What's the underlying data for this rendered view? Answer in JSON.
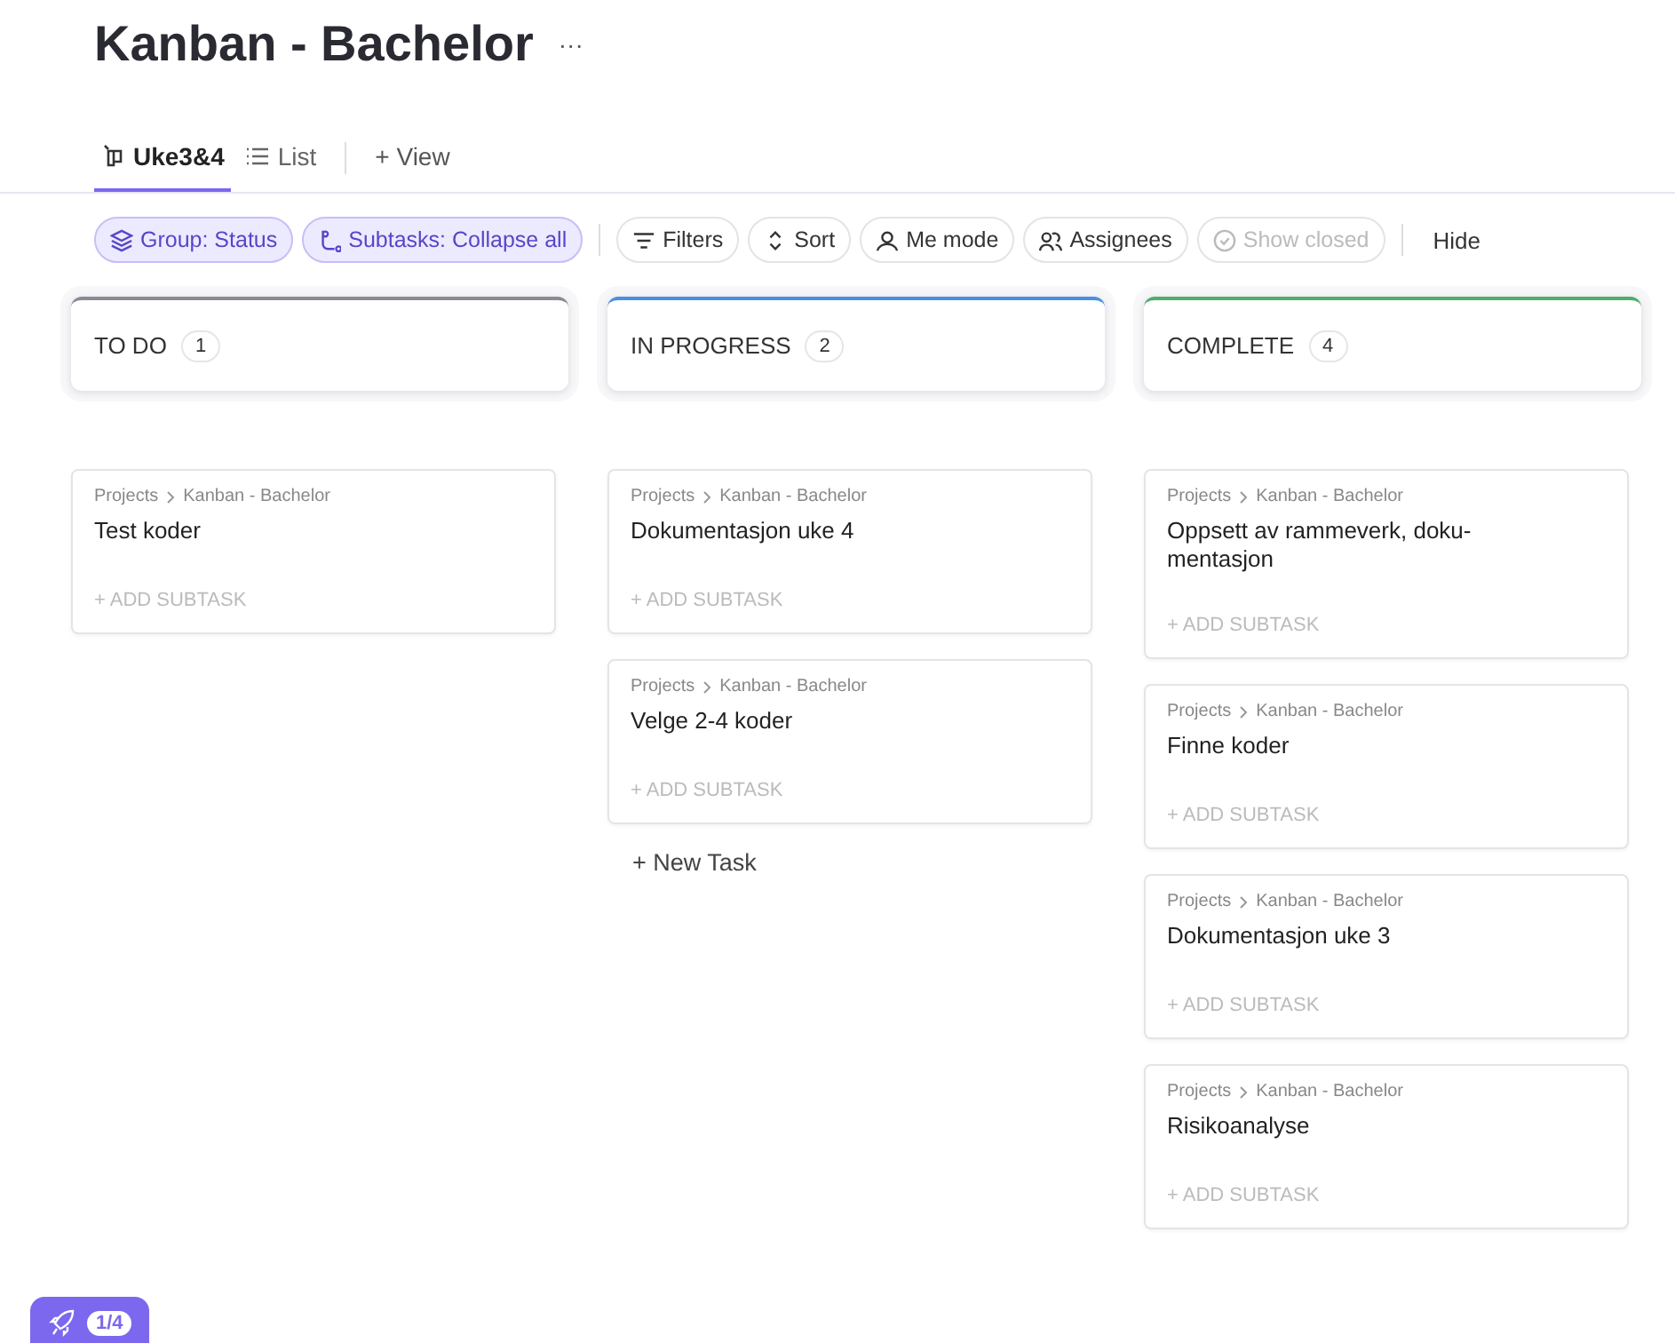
{
  "title": "Kanban - Bachelor",
  "more": "···",
  "views": [
    {
      "label": "Uke3&4",
      "kind": "board",
      "selected": true
    },
    {
      "label": "List",
      "kind": "list",
      "selected": false
    }
  ],
  "add_view": "+ View",
  "toolbar": [
    {
      "label": "Group: Status",
      "kind": "layers",
      "active": true,
      "disabled": false
    },
    {
      "label": "Subtasks: Collapse all",
      "kind": "subtask",
      "active": true,
      "disabled": false
    },
    {
      "label": "Filters",
      "kind": "filter",
      "active": false,
      "disabled": false
    },
    {
      "label": "Sort",
      "kind": "sort",
      "active": false,
      "disabled": false
    },
    {
      "label": "Me mode",
      "kind": "person",
      "active": false,
      "disabled": false
    },
    {
      "label": "Assignees",
      "kind": "people",
      "active": false,
      "disabled": false
    },
    {
      "label": "Show closed",
      "kind": "check",
      "active": false,
      "disabled": true
    }
  ],
  "hide": "Hide",
  "columns": [
    {
      "name": "TO DO",
      "count": "1",
      "color": "#8a8a96",
      "tasks": [
        {
          "path": "Projects",
          "list": "Kanban - Bachelor",
          "title": "Test koder",
          "add": "+ ADD SUBTASK"
        }
      ]
    },
    {
      "name": "IN PROGRESS",
      "count": "2",
      "color": "#4a90e2",
      "tasks": [
        {
          "path": "Projects",
          "list": "Kanban - Bachelor",
          "title": "Dokumentasjon uke 4",
          "add": "+ ADD SUBTASK"
        },
        {
          "path": "Projects",
          "list": "Kanban - Bachelor",
          "title": "Velge 2-4 koder",
          "add": "+ ADD SUBTASK"
        }
      ],
      "new_task": "+ New Task"
    },
    {
      "name": "COMPLETE",
      "count": "4",
      "color": "#4caf6a",
      "tasks": [
        {
          "path": "Projects",
          "list": "Kanban - Bachelor",
          "title": "Oppsett av rammeverk, doku-mentasjon",
          "add": "+ ADD SUBTASK"
        },
        {
          "path": "Projects",
          "list": "Kanban - Bachelor",
          "title": "Finne koder",
          "add": "+ ADD SUBTASK"
        },
        {
          "path": "Projects",
          "list": "Kanban - Bachelor",
          "title": "Dokumentasjon uke 3",
          "add": "+ ADD SUBTASK"
        },
        {
          "path": "Projects",
          "list": "Kanban - Bachelor",
          "title": "Risikoanalyse",
          "add": "+ ADD SUBTASK"
        }
      ]
    }
  ],
  "onboarding": {
    "progress": "1/4"
  }
}
